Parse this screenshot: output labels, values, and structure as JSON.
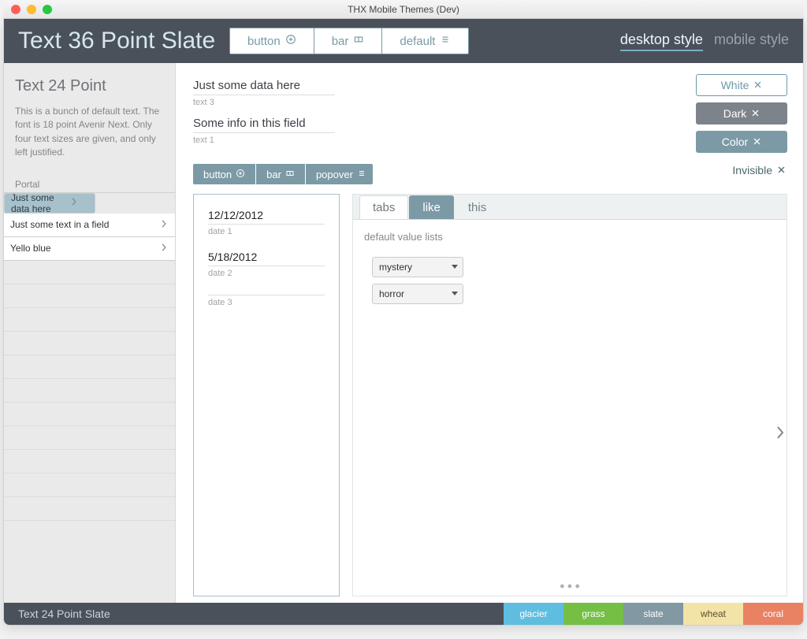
{
  "window": {
    "title": "THX Mobile Themes (Dev)"
  },
  "header": {
    "title": "Text 36 Point Slate",
    "buttons": {
      "button": "button",
      "bar": "bar",
      "default": "default"
    },
    "styles": {
      "desktop": "desktop style",
      "mobile": "mobile style"
    }
  },
  "sidebar": {
    "title": "Text 24 Point",
    "para": "This is a bunch of default text. The font is 18 point Avenir Next. Only four text sizes are given, and only left justified.",
    "portal_label": "Portal",
    "rows": [
      "Just some data here",
      "Just some text in a field",
      "Yello blue"
    ]
  },
  "main": {
    "fields": [
      {
        "value": "Just some data here",
        "label": "text 3"
      },
      {
        "value": "Some info in this field",
        "label": "text 1"
      }
    ],
    "slate_buttons": {
      "button": "button",
      "bar": "bar",
      "popover": "popover"
    },
    "card_dates": [
      {
        "value": "12/12/2012",
        "label": "date 1"
      },
      {
        "value": "5/18/2012",
        "label": "date 2"
      },
      {
        "value": "",
        "label": "date 3"
      }
    ],
    "tabcard": {
      "tabs": [
        "tabs",
        "like",
        "this"
      ],
      "body_label": "default value lists",
      "selects": [
        "mystery",
        "horror"
      ]
    }
  },
  "pills": {
    "white": "White",
    "dark": "Dark",
    "color": "Color",
    "invisible": "Invisible"
  },
  "footer": {
    "title": "Text 24 Point Slate",
    "swatches": [
      "glacier",
      "grass",
      "slate",
      "wheat",
      "coral"
    ]
  }
}
